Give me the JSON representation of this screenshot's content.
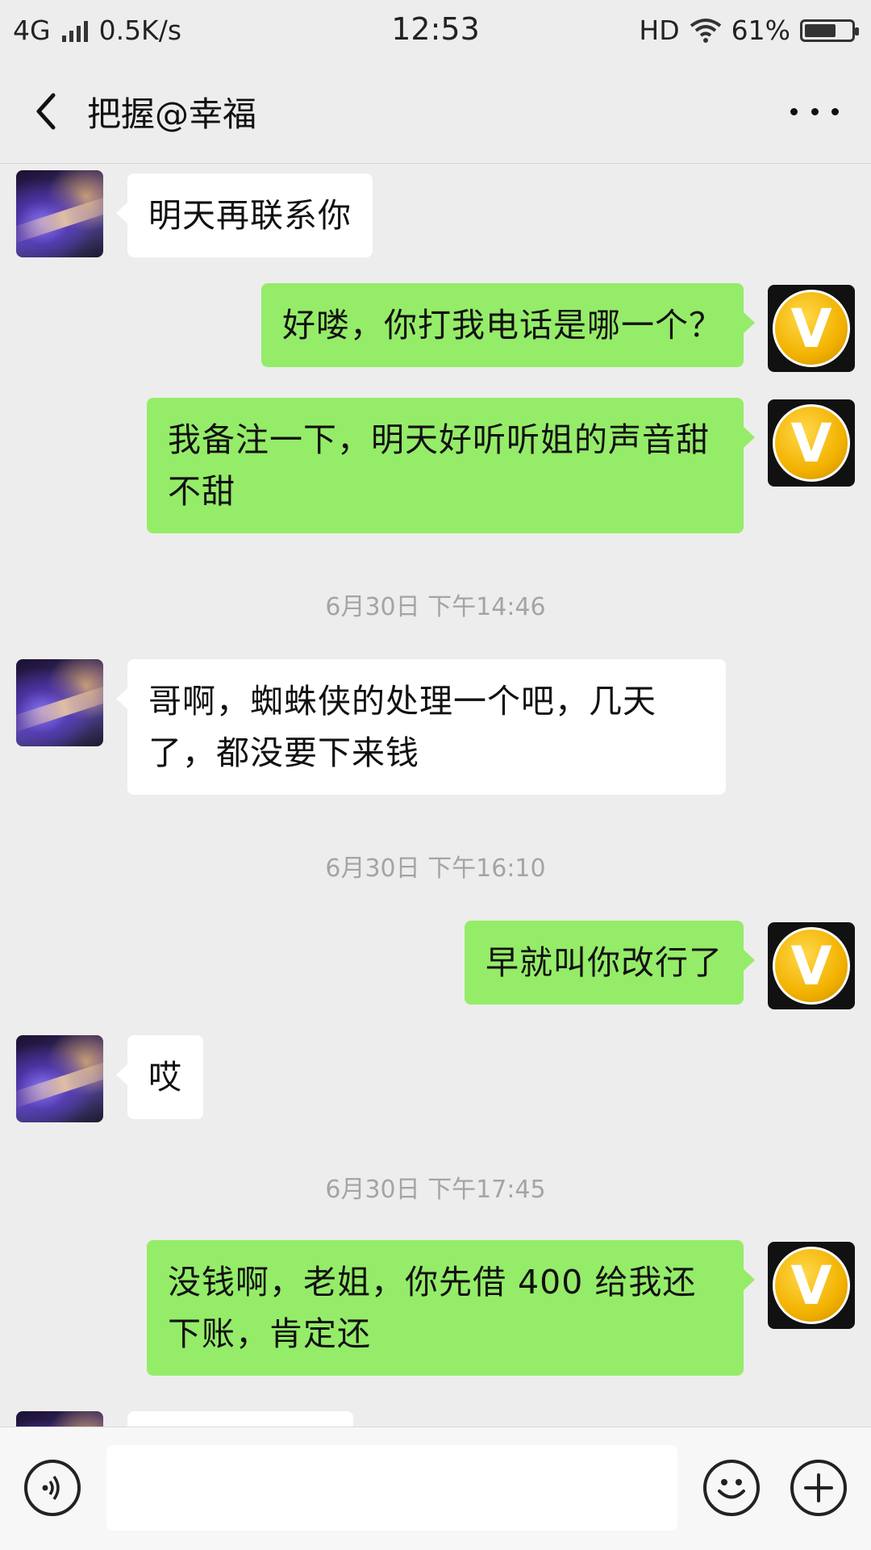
{
  "status_bar": {
    "network": "4G",
    "speed": "0.5K/s",
    "time": "12:53",
    "hd": "HD",
    "battery": "61%",
    "battery_level": 0.61
  },
  "header": {
    "title": "把握@幸福"
  },
  "messages": [
    {
      "side": "left",
      "text": "明天再联系你"
    },
    {
      "side": "right",
      "text": "好喽，你打我电话是哪一个？"
    },
    {
      "side": "right",
      "text": "我备注一下，明天好听听姐的声音甜不甜"
    },
    {
      "type": "timestamp",
      "text": "6月30日 下午14:46"
    },
    {
      "side": "left",
      "text": "哥啊，蜘蛛侠的处理一个吧，几天了，都没要下来钱"
    },
    {
      "type": "timestamp",
      "text": "6月30日 下午16:10"
    },
    {
      "side": "right",
      "text": "早就叫你改行了"
    },
    {
      "side": "left",
      "text": "哎"
    },
    {
      "type": "timestamp",
      "text": "6月30日 下午17:45"
    },
    {
      "side": "right",
      "text": "没钱啊，老姐，你先借 400 给我还下账，肯定还"
    }
  ],
  "avatars": {
    "self_letter": "V"
  },
  "input_bar": {
    "value": "",
    "icons": [
      "voice-icon",
      "emoji-icon",
      "plus-icon"
    ]
  },
  "colors": {
    "background": "#ededed",
    "bubble_self": "#95ec69",
    "bubble_other": "#ffffff"
  }
}
